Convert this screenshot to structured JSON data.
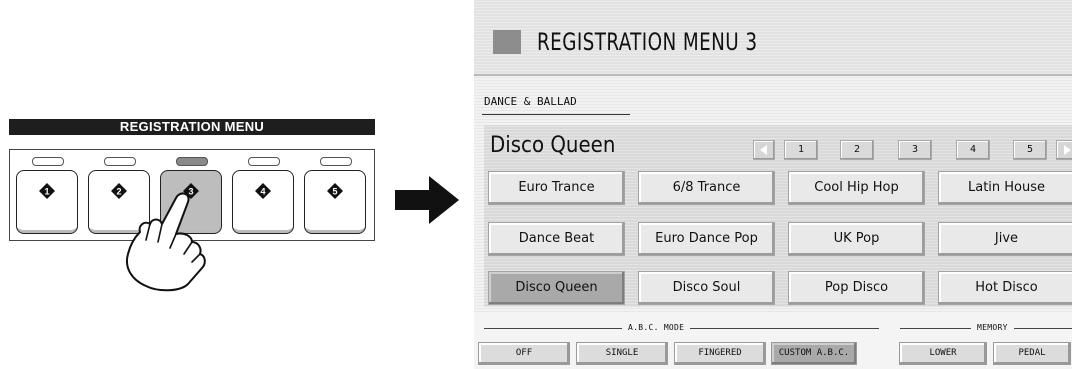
{
  "panel": {
    "title": "REGISTRATION MENU",
    "buttons": [
      {
        "number": "1",
        "active": false
      },
      {
        "number": "2",
        "active": false
      },
      {
        "number": "3",
        "active": true
      },
      {
        "number": "4",
        "active": false
      },
      {
        "number": "5",
        "active": false
      }
    ]
  },
  "screen": {
    "title": "REGISTRATION MENU 3",
    "category": "DANCE & BALLAD",
    "current_registration": "Disco Queen",
    "pages": [
      "1",
      "2",
      "3",
      "4",
      "5"
    ],
    "selected_page": "3",
    "registrations": [
      [
        "Euro Trance",
        "6/8 Trance",
        "Cool Hip Hop",
        "Latin House"
      ],
      [
        "Dance Beat",
        "Euro Dance Pop",
        "UK Pop",
        "Jive"
      ],
      [
        "Disco Queen",
        "Disco Soul",
        "Pop Disco",
        "Hot Disco"
      ]
    ],
    "selected_registration": "Disco Queen",
    "abc_mode": {
      "label": "A.B.C. MODE",
      "options": [
        "OFF",
        "SINGLE",
        "FINGERED",
        "CUSTOM A.B.C."
      ],
      "selected": "CUSTOM A.B.C."
    },
    "memory": {
      "label": "MEMORY",
      "options": [
        "LOWER",
        "PEDAL"
      ]
    }
  },
  "icons": {
    "nav_prev": "left-triangle-icon",
    "nav_next": "right-triangle-icon",
    "arrow": "right-arrow-icon",
    "hand": "pointing-hand-icon"
  }
}
